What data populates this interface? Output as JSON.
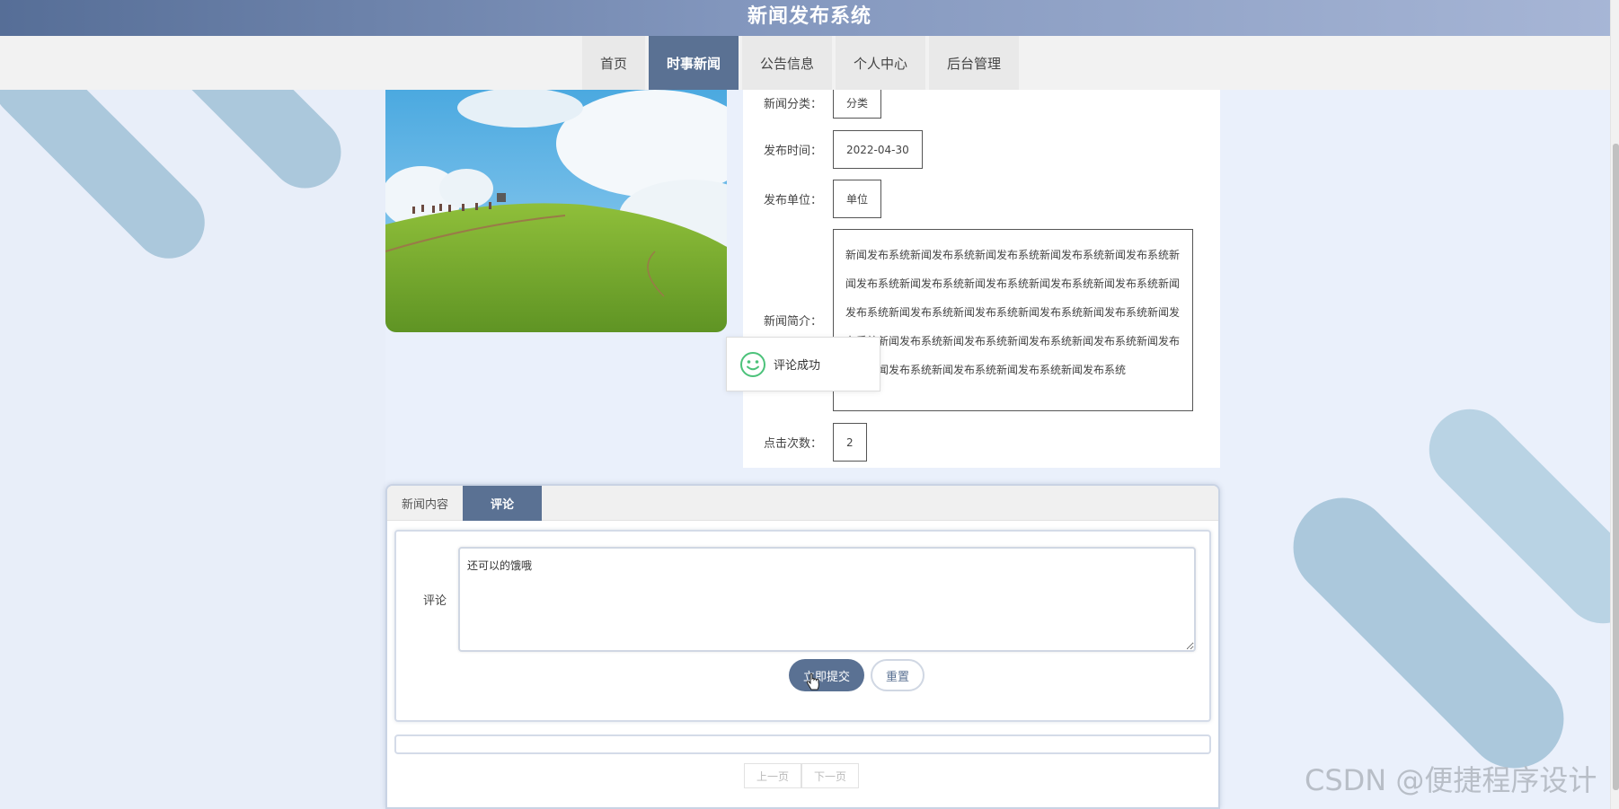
{
  "header": {
    "title": "新闻发布系统"
  },
  "nav": {
    "items": [
      {
        "label": "首页"
      },
      {
        "label": "时事新闻"
      },
      {
        "label": "公告信息"
      },
      {
        "label": "个人中心"
      },
      {
        "label": "后台管理"
      }
    ],
    "active_index": 1
  },
  "detail": {
    "category_label": "新闻分类：",
    "category_value": "分类",
    "time_label": "发布时间：",
    "time_value": "2022-04-30",
    "unit_label": "发布单位：",
    "unit_value": "单位",
    "intro_label": "新闻简介：",
    "intro_value": "新闻发布系统新闻发布系统新闻发布系统新闻发布系统新闻发布系统新闻发布系统新闻发布系统新闻发布系统新闻发布系统新闻发布系统新闻发布系统新闻发布系统新闻发布系统新闻发布系统新闻发布系统新闻发布系统新闻发布系统新闻发布系统新闻发布系统新闻发布系统新闻发布系统新闻发布系统新闻发布系统新闻发布系统新闻发布系统",
    "clicks_label": "点击次数：",
    "clicks_value": "2"
  },
  "toast": {
    "text": "评论成功",
    "icon": "smile-icon"
  },
  "tabs": [
    {
      "label": "新闻内容"
    },
    {
      "label": "评论"
    }
  ],
  "comment_form": {
    "label": "评论",
    "value": "还可以的饿哦",
    "submit_label": "立即提交",
    "reset_label": "重置"
  },
  "pager": {
    "prev_label": "上一页",
    "next_label": "下一页"
  },
  "watermark": "CSDN @便捷程序设计",
  "colors": {
    "accent": "#5a7193",
    "header_start": "#566e97",
    "background": "#eaf0fb"
  }
}
